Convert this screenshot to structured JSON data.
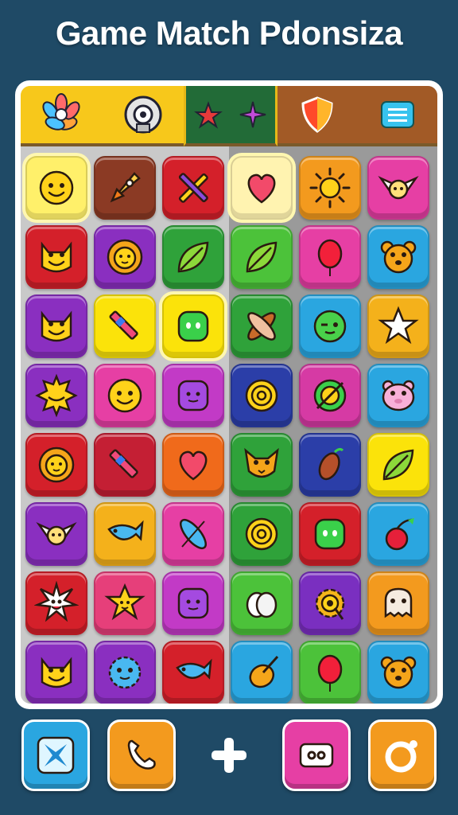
{
  "title": "Game Match Pdonsiza",
  "tabs": [
    {
      "name": "tab-flower-lock",
      "icons": [
        "flower-icon",
        "lock-icon"
      ]
    },
    {
      "name": "tab-stars",
      "icons": [
        "star-red-icon",
        "star-purple-icon"
      ]
    },
    {
      "name": "tab-shield-list",
      "icons": [
        "shield-icon",
        "list-icon"
      ]
    }
  ],
  "board": {
    "rows": [
      [
        {
          "icon": "smiley-face-icon",
          "color": "#fff06a",
          "selected": true
        },
        {
          "icon": "rocket-icon",
          "color": "#8b3a24"
        },
        {
          "icon": "crossed-pencils-icon",
          "color": "#d4202a"
        },
        {
          "icon": "heart-icon",
          "color": "#fff3b0",
          "selected": true
        },
        {
          "icon": "sun-icon",
          "color": "#f39a1e"
        },
        {
          "icon": "winged-creature-icon",
          "color": "#e63fa4"
        }
      ],
      [
        {
          "icon": "cat-face-icon",
          "color": "#d4202a"
        },
        {
          "icon": "lion-face-icon",
          "color": "#8a2fc0"
        },
        {
          "icon": "leaf-icon",
          "color": "#2fa23a"
        },
        {
          "icon": "leaf-icon",
          "color": "#4cc23a"
        },
        {
          "icon": "balloon-icon",
          "color": "#e63fa4"
        },
        {
          "icon": "bear-face-icon",
          "color": "#2aa6e0"
        }
      ],
      [
        {
          "icon": "cat-face-icon",
          "color": "#8a2fc0"
        },
        {
          "icon": "crayon-icon",
          "color": "#fbe30a"
        },
        {
          "icon": "blob-face-icon",
          "color": "#fbe30a",
          "selected": true
        },
        {
          "icon": "crossed-feathers-icon",
          "color": "#2fa23a"
        },
        {
          "icon": "winking-face-icon",
          "color": "#2aa6e0"
        },
        {
          "icon": "star-icon",
          "color": "#f4b11b"
        }
      ],
      [
        {
          "icon": "sun-face-icon",
          "color": "#8a2fc0"
        },
        {
          "icon": "smiley-face-icon",
          "color": "#e63fa4"
        },
        {
          "icon": "square-face-icon",
          "color": "#c23ac6"
        },
        {
          "icon": "spiral-icon",
          "color": "#2b3ea8"
        },
        {
          "icon": "target-icon",
          "color": "#d63aa4"
        },
        {
          "icon": "pig-face-icon",
          "color": "#2aa6e0"
        }
      ],
      [
        {
          "icon": "lion-face-icon",
          "color": "#d4202a"
        },
        {
          "icon": "crayon-icon",
          "color": "#c41f34"
        },
        {
          "icon": "heart-icon",
          "color": "#f06a1b"
        },
        {
          "icon": "fox-face-icon",
          "color": "#2fa23a"
        },
        {
          "icon": "seed-icon",
          "color": "#2b3ea8"
        },
        {
          "icon": "leaf-icon",
          "color": "#fbe30a"
        }
      ],
      [
        {
          "icon": "winged-creature-icon",
          "color": "#8a2fc0"
        },
        {
          "icon": "fish-icon",
          "color": "#f4b11b"
        },
        {
          "icon": "feather-icon",
          "color": "#e63fa4"
        },
        {
          "icon": "spiral-icon",
          "color": "#2fa23a"
        },
        {
          "icon": "blob-face-icon",
          "color": "#d4202a"
        },
        {
          "icon": "cherry-icon",
          "color": "#2aa6e0"
        }
      ],
      [
        {
          "icon": "starburst-face-icon",
          "color": "#d4202a"
        },
        {
          "icon": "star-face-icon",
          "color": "#e63f7a"
        },
        {
          "icon": "square-face-icon",
          "color": "#c23ac6"
        },
        {
          "icon": "egg-icon",
          "color": "#4cc23a"
        },
        {
          "icon": "gear-icon",
          "color": "#7a2fc0"
        },
        {
          "icon": "ghost-face-icon",
          "color": "#f39a1e"
        }
      ],
      [
        {
          "icon": "cat-face-icon",
          "color": "#8a2fc0"
        },
        {
          "icon": "puffball-icon",
          "color": "#8a2fc0"
        },
        {
          "icon": "fish-icon",
          "color": "#d4202a"
        },
        {
          "icon": "nut-icon",
          "color": "#2aa6e0"
        },
        {
          "icon": "balloon-icon",
          "color": "#4cc23a"
        },
        {
          "icon": "bear-face-icon",
          "color": "#2aa6e0"
        }
      ]
    ]
  },
  "bottom_bar": [
    {
      "name": "shuffle-button",
      "icon": "shuffle-icon",
      "color": "#2aa6e0"
    },
    {
      "name": "phone-button",
      "icon": "phone-icon",
      "color": "#f39a1e"
    },
    {
      "name": "add-button",
      "icon": "plus-icon",
      "color": ""
    },
    {
      "name": "chat-button",
      "icon": "chat-icon",
      "color": "#e63fa4"
    },
    {
      "name": "settings-button",
      "icon": "ring-icon",
      "color": "#f39a1e"
    }
  ]
}
